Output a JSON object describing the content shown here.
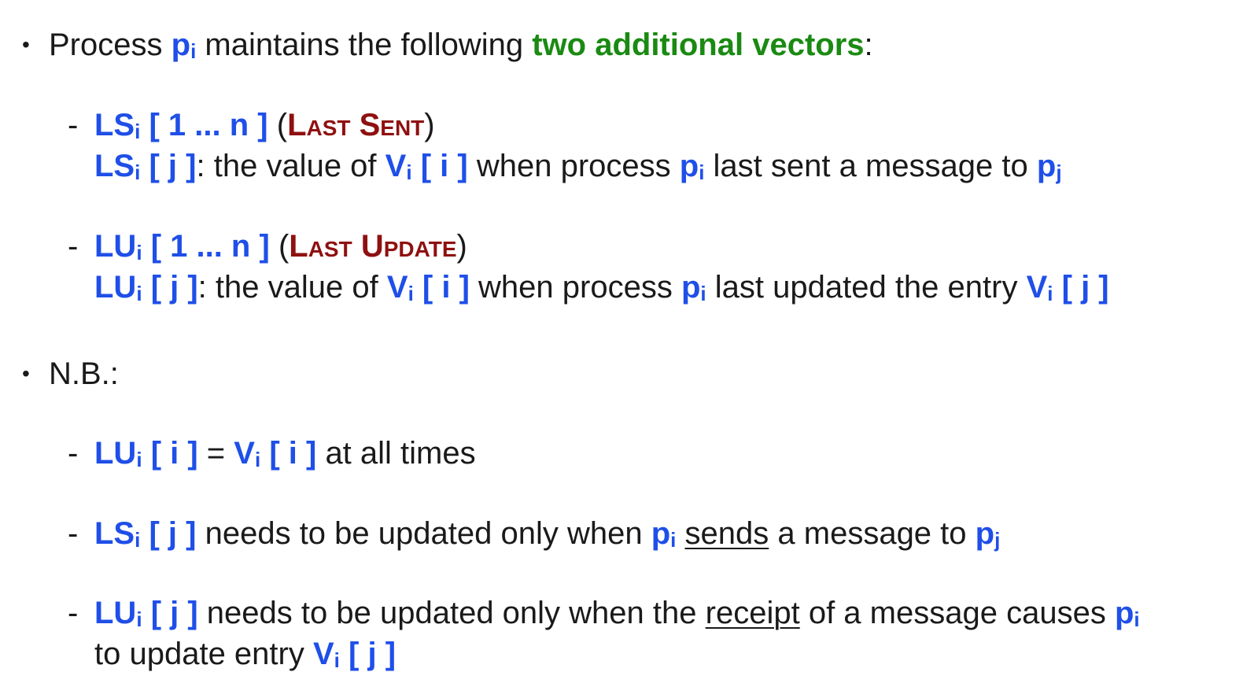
{
  "colors": {
    "blue": "#1f4fe8",
    "green": "#1a8a12",
    "darkred": "#8f1010",
    "text": "#1a1a1a"
  },
  "bullet_glyph": "•",
  "dash_glyph": "-",
  "item1": {
    "intro": "Process",
    "p": "p",
    "i": "i",
    "middle": "maintains the following",
    "highlight": "two additional vectors",
    "end": ":"
  },
  "ls": {
    "head_name": "LS",
    "i": "i",
    "head_range": "[ 1 ... n ]",
    "open_paren": "(",
    "label": "Last Sent",
    "close_paren": ")",
    "def_name": "LS",
    "def_index": "[ j ]",
    "def_colon": ":",
    "def_text1": "the value of",
    "v": "V",
    "v_index": "[ i ]",
    "def_text2": "when process",
    "p": "p",
    "def_text3": "last sent a message to",
    "pj": "p",
    "j": "j"
  },
  "lu": {
    "head_name": "LU",
    "i": "i",
    "head_range": "[ 1 ... n ]",
    "open_paren": "(",
    "label": "Last Update",
    "close_paren": ")",
    "def_name": "LU",
    "def_index": "[ j ]",
    "def_colon": ":",
    "def_text1": "the value of",
    "v": "V",
    "v_index": "[ i ]",
    "def_text2": "when process",
    "p": "p",
    "def_text3": "last updated the entry",
    "v2": "V",
    "v2_index": "[ j ]"
  },
  "nb": {
    "label": "N.B.:"
  },
  "nb1": {
    "name": "LU",
    "i": "i",
    "index": "[ i ]",
    "eq": "=",
    "v": "V",
    "v_index": "[ i ]",
    "text": "at all times"
  },
  "nb2": {
    "name": "LS",
    "i": "i",
    "index": "[ j ]",
    "text1": "needs to be updated only when",
    "p": "p",
    "underlined": "sends",
    "text2": "a message to",
    "pj": "p",
    "j": "j"
  },
  "nb3": {
    "name": "LU",
    "i": "i",
    "index": "[ j ]",
    "text1": "needs to be updated only when the",
    "underlined": "receipt",
    "text2": "of a message causes",
    "p": "p",
    "text3": "to update entry",
    "v": "V",
    "v_index": "[ j ]"
  }
}
